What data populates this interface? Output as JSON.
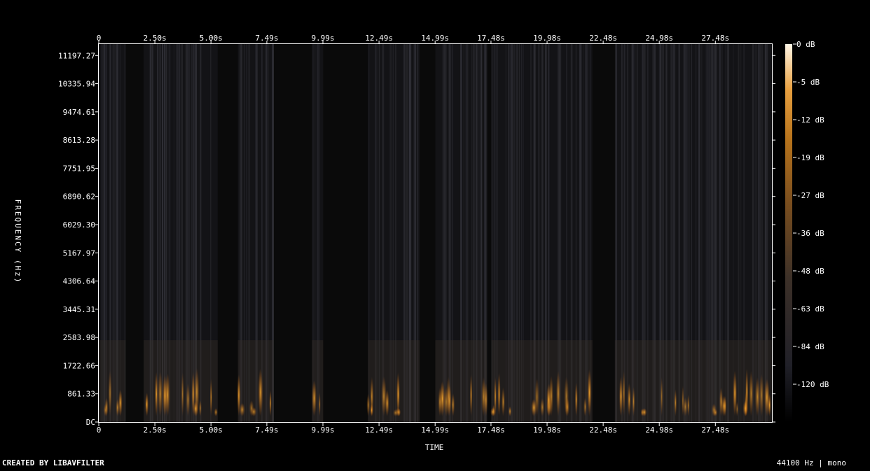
{
  "chart_data": {
    "type": "heatmap",
    "title": "",
    "xlabel": "TIME",
    "ylabel": "FREQUENCY (Hz)",
    "x_ticks": [
      "0",
      "2.50s",
      "5.00s",
      "7.49s",
      "9.99s",
      "12.49s",
      "14.99s",
      "17.48s",
      "19.98s",
      "22.48s",
      "24.98s",
      "27.48s"
    ],
    "x_tick_values": [
      0,
      2.5,
      5.0,
      7.49,
      9.99,
      12.49,
      14.99,
      17.48,
      19.98,
      22.48,
      24.98,
      27.48
    ],
    "xlim": [
      0,
      30.0
    ],
    "y_ticks": [
      "DC",
      "861.33",
      "1722.66",
      "2583.98",
      "3445.31",
      "4306.64",
      "5167.97",
      "6029.30",
      "6890.62",
      "7751.95",
      "8613.28",
      "9474.61",
      "10335.94",
      "11197.27"
    ],
    "y_tick_values": [
      0,
      861.33,
      1722.66,
      2583.98,
      3445.31,
      4306.64,
      5167.97,
      6029.3,
      6890.62,
      7751.95,
      8613.28,
      9474.61,
      10335.94,
      11197.27
    ],
    "ylim": [
      0,
      11545
    ],
    "colorbar": {
      "labels": [
        "0 dB",
        "-5 dB",
        "-12 dB",
        "-19 dB",
        "-27 dB",
        "-36 dB",
        "-48 dB",
        "-63 dB",
        "-84 dB",
        "-120 dB"
      ],
      "values_db": [
        0,
        -5,
        -12,
        -19,
        -27,
        -36,
        -48,
        -63,
        -84,
        -120
      ],
      "colors": [
        "#fff6e6",
        "#e8a040",
        "#b8741c",
        "#7a4e1e",
        "#3c3028",
        "#202028",
        "#000000"
      ]
    },
    "speech_segments_s": [
      [
        0.0,
        1.2
      ],
      [
        2.0,
        5.3
      ],
      [
        6.2,
        7.8
      ],
      [
        9.5,
        10.0
      ],
      [
        12.0,
        14.3
      ],
      [
        15.0,
        17.3
      ],
      [
        17.5,
        22.0
      ],
      [
        23.0,
        30.0
      ]
    ],
    "colors": {
      "background": "#000000",
      "text": "#ffffff",
      "axis": "#ffffff"
    }
  },
  "footer": {
    "created_by": "CREATED BY LIBAVFILTER",
    "info": "44100 Hz | mono"
  }
}
